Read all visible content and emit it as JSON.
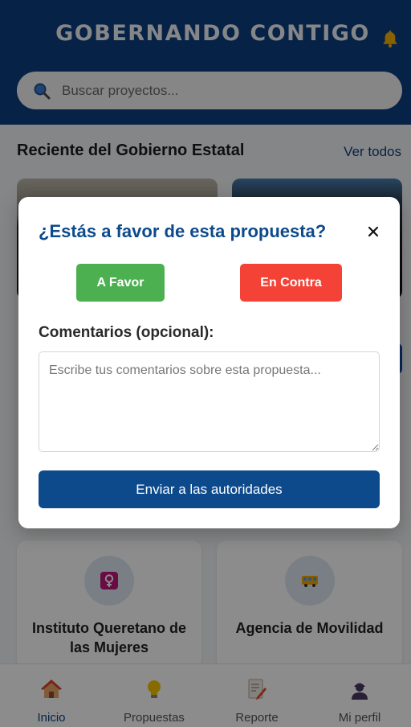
{
  "header": {
    "logo_text": "GOBERNANDO CONTIGO",
    "search_placeholder": "Buscar proyectos..."
  },
  "recent": {
    "title": "Reciente del Gobierno Estatal",
    "see_all": "Ver todos"
  },
  "institutions": [
    {
      "name": "Instituto Queretano de las Mujeres",
      "icon": "female-sign-icon"
    },
    {
      "name": "Agencia de Movilidad",
      "icon": "bus-icon"
    }
  ],
  "bottom_nav": [
    {
      "label": "Inicio",
      "icon": "home-icon",
      "active": true
    },
    {
      "label": "Propuestas",
      "icon": "lightbulb-icon",
      "active": false
    },
    {
      "label": "Reporte",
      "icon": "report-icon",
      "active": false
    },
    {
      "label": "Mi perfil",
      "icon": "user-icon",
      "active": false
    }
  ],
  "modal": {
    "title": "¿Estás a favor de esta propuesta?",
    "favor_label": "A Favor",
    "contra_label": "En Contra",
    "comments_label": "Comentarios (opcional):",
    "comments_placeholder": "Escribe tus comentarios sobre esta propuesta...",
    "send_label": "Enviar a las autoridades"
  },
  "colors": {
    "brand": "#0d3f82",
    "favor": "#4caf50",
    "contra": "#f44336"
  }
}
